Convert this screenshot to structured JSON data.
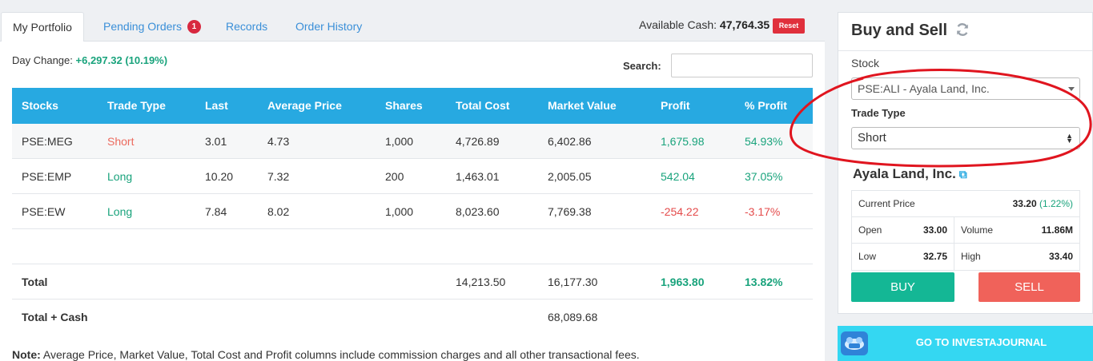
{
  "tabs": [
    {
      "label": "My Portfolio"
    },
    {
      "label": "Pending Orders",
      "badge": "1"
    },
    {
      "label": "Records"
    },
    {
      "label": "Order History"
    }
  ],
  "cash": {
    "label": "Available Cash:",
    "value": "47,764.35",
    "reset_label": "Reset"
  },
  "day_change": {
    "label": "Day Change:",
    "value": "+6,297.32 (10.19%)"
  },
  "search": {
    "label": "Search:",
    "value": ""
  },
  "table": {
    "headers": [
      "Stocks",
      "Trade Type",
      "Last",
      "Average Price",
      "Shares",
      "Total Cost",
      "Market Value",
      "Profit",
      "% Profit"
    ],
    "rows": [
      [
        "PSE:MEG",
        "Short",
        "3.01",
        "4.73",
        "1,000",
        "4,726.89",
        "6,402.86",
        "1,675.98",
        "54.93%"
      ],
      [
        "PSE:EMP",
        "Long",
        "10.20",
        "7.32",
        "200",
        "1,463.01",
        "2,005.05",
        "542.04",
        "37.05%"
      ],
      [
        "PSE:EW",
        "Long",
        "7.84",
        "8.02",
        "1,000",
        "8,023.60",
        "7,769.38",
        "-254.22",
        "-3.17%"
      ]
    ],
    "total": {
      "label": "Total",
      "total_cost": "14,213.50",
      "market_value": "16,177.30",
      "profit": "1,963.80",
      "pct_profit": "13.82%"
    },
    "total_cash": {
      "label": "Total + Cash",
      "market_value": "68,089.68"
    }
  },
  "note": {
    "label": "Note:",
    "text": "Average Price, Market Value, Total Cost and Profit columns include commission charges and all other transactional fees."
  },
  "buy_sell": {
    "title": "Buy and Sell",
    "stock_label": "Stock",
    "stock_value": "PSE:ALI - Ayala Land, Inc.",
    "trade_type_label": "Trade Type",
    "trade_type_value": "Short",
    "company": "Ayala Land, Inc.",
    "current_price_label": "Current Price",
    "current_price": "33.20",
    "current_change": "(1.22%)",
    "open_label": "Open",
    "open": "33.00",
    "volume_label": "Volume",
    "volume": "11.86M",
    "low_label": "Low",
    "low": "32.75",
    "high_label": "High",
    "high": "33.40",
    "buy_label": "BUY",
    "sell_label": "SELL"
  },
  "journal": {
    "label": "GO TO INVESTAJOURNAL"
  },
  "colors": {
    "header_blue": "#27a9e1",
    "profit_green": "#19a37c",
    "loss_red": "#e44b4b",
    "buy_green": "#14b795",
    "sell_red": "#f0625a",
    "annotation_red": "#e0151f"
  }
}
